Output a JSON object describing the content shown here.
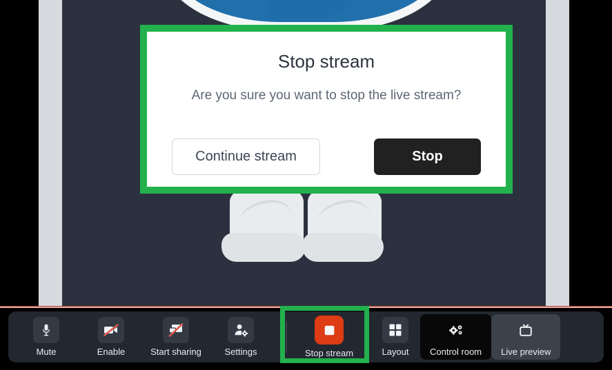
{
  "stage": {
    "video_background_color": "#2b313e",
    "rail_color": "#d7dbdf",
    "letterbox_color": "#000000",
    "avatar_shirt_color": "#2170ac",
    "avatar_boot_color": "#e9ecee"
  },
  "modal": {
    "highlight_color": "#22b14c",
    "title": "Stop stream",
    "message": "Are you sure you want to stop the live stream?",
    "continue_label": "Continue stream",
    "stop_label": "Stop",
    "background": "#ffffff",
    "primary_button_color": "#212121"
  },
  "toolbar": {
    "background": "#23272f",
    "selection_color": "#22b14c",
    "left_items": [
      {
        "label": "Mute",
        "icon": "microphone-icon",
        "state": "default"
      },
      {
        "label": "Enable",
        "icon": "camera-off-icon",
        "state": "disabled"
      },
      {
        "label": "Start sharing",
        "icon": "screen-share-off-icon",
        "state": "disabled"
      },
      {
        "label": "Settings",
        "icon": "person-gear-icon",
        "state": "default"
      }
    ],
    "right_items": [
      {
        "label": "Stop stream",
        "icon": "stop-square-icon",
        "state": "recording",
        "accent": "#dd3c14",
        "selected": true
      },
      {
        "label": "Layout",
        "icon": "grid-layout-icon",
        "state": "default"
      },
      {
        "label": "Control room",
        "icon": "gears-icon",
        "state": "active"
      },
      {
        "label": "Live preview",
        "icon": "tv-icon",
        "state": "muted"
      }
    ]
  },
  "separator": {
    "color": "#e8a79c"
  }
}
